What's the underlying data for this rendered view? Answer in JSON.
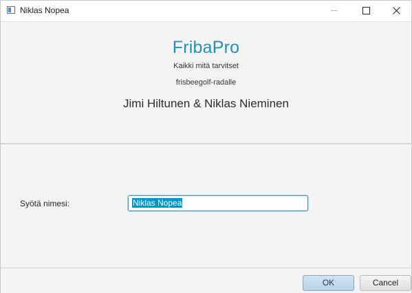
{
  "window": {
    "title": "Niklas Nopea"
  },
  "header": {
    "brand": "FribaPro",
    "tagline_line1": "Kaikki mitä tarvitset",
    "tagline_line2": "frisbeegolf-radalle",
    "authors": "Jimi Hiltunen & Niklas Nieminen"
  },
  "form": {
    "name_label": "Syötä nimesi:",
    "name_value": "Niklas Nopea"
  },
  "buttons": {
    "ok_label": "OK",
    "cancel_label": "Cancel"
  },
  "colors": {
    "brand": "#2190b8",
    "input_focus": "#3a9ad6",
    "selection": "#0096c9"
  },
  "icons": {
    "app": "window-icon",
    "minimize": "minimize-icon",
    "maximize": "maximize-icon",
    "close": "close-icon"
  }
}
